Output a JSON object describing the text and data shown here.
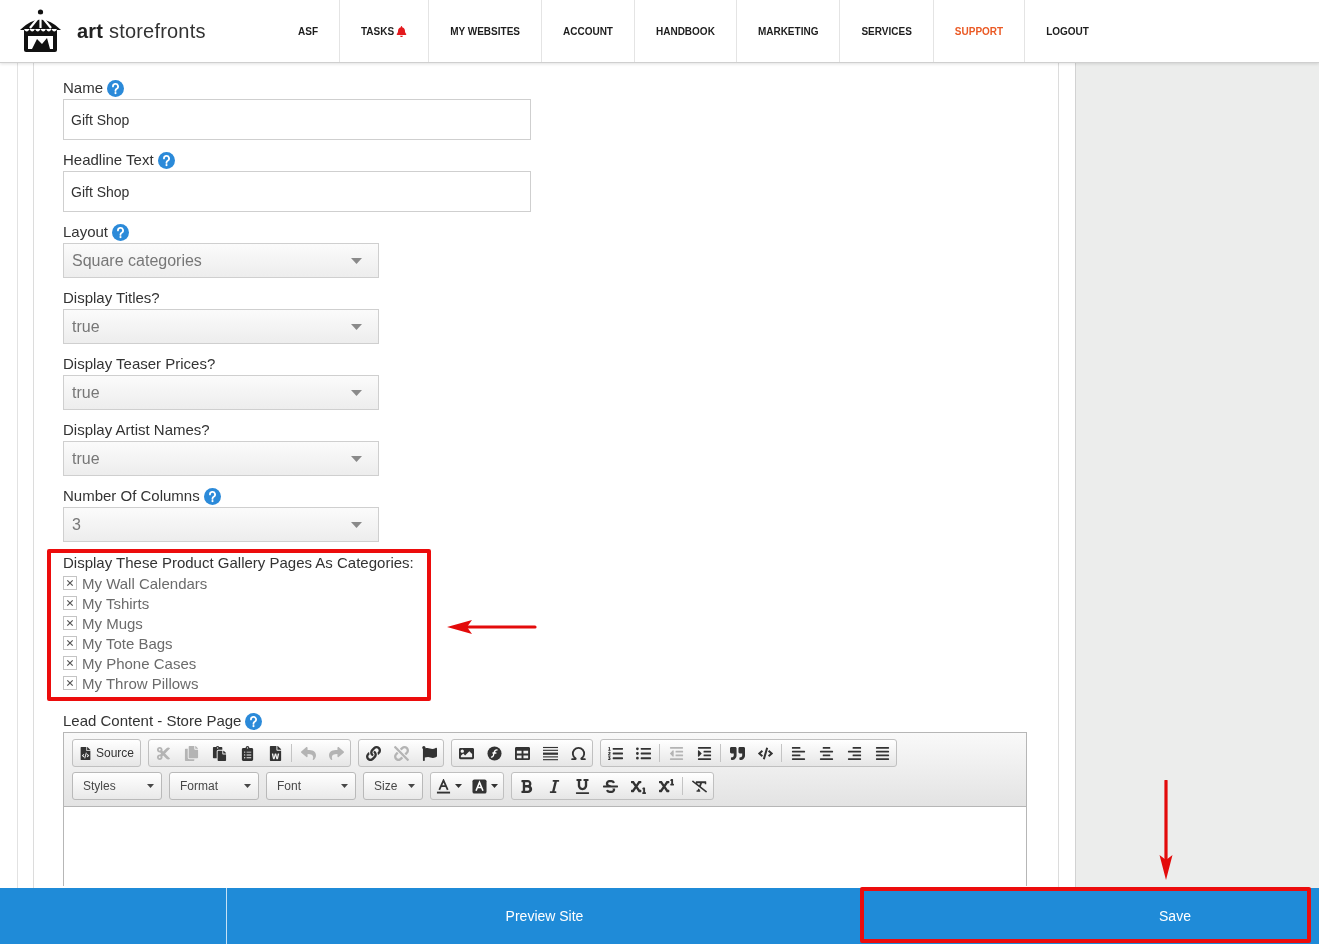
{
  "header": {
    "brand": "**art** storefronts",
    "nav": [
      {
        "label": "ASF",
        "selected": false,
        "notification": false
      },
      {
        "label": "TASKS",
        "selected": false,
        "notification": true
      },
      {
        "label": "MY WEBSITES",
        "selected": false,
        "notification": false
      },
      {
        "label": "ACCOUNT",
        "selected": false,
        "notification": false
      },
      {
        "label": "HANDBOOK",
        "selected": false,
        "notification": false
      },
      {
        "label": "MARKETING",
        "selected": false,
        "notification": false
      },
      {
        "label": "SERVICES",
        "selected": false,
        "notification": false
      },
      {
        "label": "SUPPORT",
        "selected": true,
        "notification": false
      },
      {
        "label": "LOGOUT",
        "selected": false,
        "notification": false
      }
    ]
  },
  "form": {
    "fields": [
      {
        "kind": "text",
        "label": "Name",
        "help": true,
        "value": "Gift Shop"
      },
      {
        "kind": "text",
        "label": "Headline Text",
        "help": true,
        "value": "Gift Shop"
      },
      {
        "kind": "select",
        "label": "Layout",
        "help": true,
        "value": "Square categories"
      },
      {
        "kind": "select",
        "label": "Display Titles?",
        "help": false,
        "value": "true"
      },
      {
        "kind": "select",
        "label": "Display Teaser Prices?",
        "help": false,
        "value": "true"
      },
      {
        "kind": "select",
        "label": "Display Artist Names?",
        "help": false,
        "value": "true"
      },
      {
        "kind": "select",
        "label": "Number Of Columns",
        "help": true,
        "value": "3"
      }
    ],
    "categories": {
      "label": "Display These Product Gallery Pages As Categories:",
      "highlighted": true,
      "items": [
        {
          "label": "My Wall Calendars",
          "checked": true
        },
        {
          "label": "My Tshirts",
          "checked": true
        },
        {
          "label": "My Mugs",
          "checked": true
        },
        {
          "label": "My Tote Bags",
          "checked": true
        },
        {
          "label": "My Phone Cases",
          "checked": true
        },
        {
          "label": "My Throw Pillows",
          "checked": true
        }
      ]
    },
    "editor": {
      "label": "Lead Content - Store Page",
      "help": true,
      "toolbar_rows": [
        {
          "groups": [
            {
              "kind": "buttons",
              "buttons": [
                {
                  "label": "Source",
                  "disabled": false
                }
              ]
            },
            {
              "kind": "buttons",
              "buttons": [
                {
                  "disabled": true
                },
                {
                  "disabled": true
                },
                {
                  "disabled": false
                },
                {
                  "disabled": false
                },
                {
                  "disabled": false
                },
                {
                  "disabled": true
                },
                {
                  "disabled": true
                }
              ]
            },
            {
              "kind": "buttons",
              "buttons": [
                {
                  "disabled": false
                },
                {
                  "disabled": true
                },
                {
                  "disabled": false
                }
              ]
            },
            {
              "kind": "buttons",
              "buttons": [
                {
                  "disabled": false
                },
                {
                  "disabled": false
                },
                {
                  "disabled": false
                },
                {
                  "disabled": false
                },
                {
                  "disabled": false
                }
              ]
            },
            {
              "kind": "buttons",
              "buttons": [
                {
                  "disabled": false
                },
                {
                  "disabled": false
                },
                {
                  "disabled": true
                },
                {
                  "disabled": false
                },
                {
                  "disabled": false
                },
                {
                  "disabled": false
                },
                {
                  "disabled": false
                },
                {
                  "disabled": false
                },
                {
                  "disabled": false
                },
                {
                  "disabled": false
                }
              ]
            }
          ]
        },
        {
          "groups": [
            {
              "kind": "combo",
              "label": "Styles"
            },
            {
              "kind": "combo",
              "label": "Format"
            },
            {
              "kind": "combo",
              "label": "Font"
            },
            {
              "kind": "combo",
              "label": "Size"
            },
            {
              "kind": "buttons",
              "buttons": [
                {
                  "disabled": false
                },
                {
                  "disabled": false
                }
              ]
            },
            {
              "kind": "buttons",
              "buttons": [
                {
                  "disabled": false
                },
                {
                  "disabled": false
                },
                {
                  "disabled": false
                },
                {
                  "disabled": false
                },
                {
                  "disabled": false
                },
                {
                  "disabled": false
                },
                {
                  "disabled": false
                }
              ]
            }
          ]
        }
      ]
    }
  },
  "bottom_bar": {
    "buttons": [
      {
        "label": "Preview Site",
        "highlighted": false
      },
      {
        "label": "Save",
        "highlighted": true
      }
    ]
  }
}
